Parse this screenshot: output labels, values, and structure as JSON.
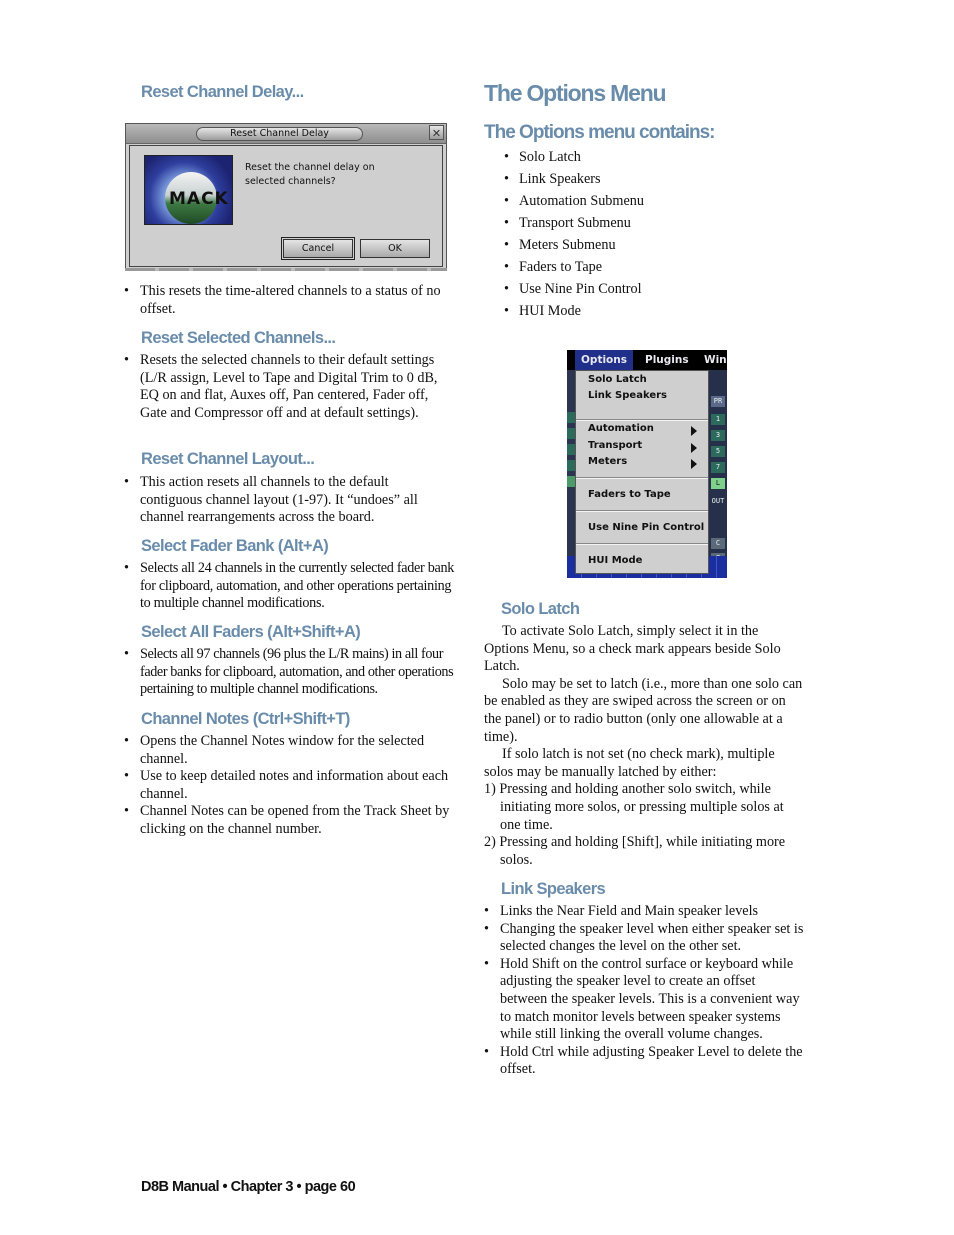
{
  "left_column": {
    "reset_channel_delay": {
      "heading": "Reset Channel Delay...",
      "bullets": [
        "This resets the time-altered channels to a status of no offset."
      ]
    },
    "dialog": {
      "title": "Reset Channel Delay",
      "close_icon": "close-icon",
      "logo_text": "MACK",
      "message": "Reset the channel delay on selected channels?",
      "cancel_label": "Cancel",
      "ok_label": "OK"
    },
    "reset_selected_channels": {
      "heading": "Reset Selected Channels...",
      "bullets": [
        "Resets the selected channels to their default settings (L/R assign, Level to Tape and Digital Trim to 0 dB, EQ on and flat, Auxes off, Pan centered, Fader off, Gate and Compressor off and at default settings)."
      ]
    },
    "reset_channel_layout": {
      "heading": "Reset Channel Layout...",
      "bullets": [
        "This action resets all channels to the default contiguous channel layout (1-97). It “undoes” all channel rearrangements across the board."
      ]
    },
    "select_fader_bank": {
      "heading": "Select Fader Bank (Alt+A)",
      "bullets": [
        "Selects all 24 channels in the currently selected fader bank for clipboard, automation, and other operations pertaining to multiple channel modifications."
      ]
    },
    "select_all_faders": {
      "heading": "Select All Faders (Alt+Shift+A)",
      "bullets": [
        "Selects all 97 channels (96 plus the L/R mains) in all four fader banks for clipboard, automation, and other operations pertaining to multiple channel modifications."
      ]
    },
    "channel_notes": {
      "heading": "Channel Notes (Ctrl+Shift+T)",
      "bullets": [
        "Opens the Channel Notes window for the selected channel.",
        "Use to keep detailed notes and information about each channel.",
        "Channel Notes can be opened from the Track Sheet by clicking on the channel number."
      ]
    }
  },
  "right_column": {
    "title": "The Options Menu",
    "contains_heading": "The Options menu contains:",
    "contains_items": [
      "Solo Latch",
      "Link Speakers",
      "Automation Submenu",
      "Transport Submenu",
      "Meters Submenu",
      "Faders to Tape",
      "Use Nine Pin Control",
      "HUI Mode"
    ],
    "menu_screenshot": {
      "menubar": [
        "Options",
        "Plugins",
        "Win"
      ],
      "items": [
        {
          "label": "Solo Latch",
          "submenu": false
        },
        {
          "label": "Link Speakers",
          "submenu": false
        },
        {
          "label": "Automation",
          "submenu": true
        },
        {
          "label": "Transport",
          "submenu": true
        },
        {
          "label": "Meters",
          "submenu": true
        },
        {
          "label": "Faders to Tape",
          "submenu": false
        },
        {
          "label": "Use Nine Pin Control",
          "submenu": false
        },
        {
          "label": "HUI Mode",
          "submenu": false
        }
      ],
      "right_strip_labels": [
        "PR",
        "1",
        "3",
        "5",
        "7",
        "L",
        "OUT",
        "C",
        "Ø"
      ]
    },
    "solo_latch": {
      "heading": "Solo Latch",
      "paragraphs": [
        "To activate Solo Latch, simply select it in the Options Menu, so a check mark appears beside Solo Latch.",
        "Solo may be set to latch (i.e., more than one solo can be enabled as they are swiped across the screen or on the panel) or to radio button (only one allowable at a time).",
        "If solo latch is not set (no check mark), multiple solos may be manually latched by either:"
      ],
      "numbered": [
        "1) Pressing and holding another solo switch, while initiating more solos, or pressing multiple solos at one time.",
        "2) Pressing and holding [Shift], while initiating more solos."
      ]
    },
    "link_speakers": {
      "heading": "Link Speakers",
      "bullets": [
        "Links the Near Field and Main speaker levels",
        "Changing the speaker level when either speaker set is selected changes the level on the other set.",
        "Hold Shift on the control surface or keyboard while adjusting the speaker level to create an offset between the speaker levels. This is a convenient way to match monitor levels between speaker systems while still linking the overall volume changes.",
        "Hold Ctrl while adjusting Speaker Level to delete the offset."
      ]
    }
  },
  "footer": {
    "text": "D8B Manual • Chapter 3 • page  60"
  },
  "colors": {
    "heading": "#6a8cab",
    "menu_active": "#1f2f8a"
  }
}
